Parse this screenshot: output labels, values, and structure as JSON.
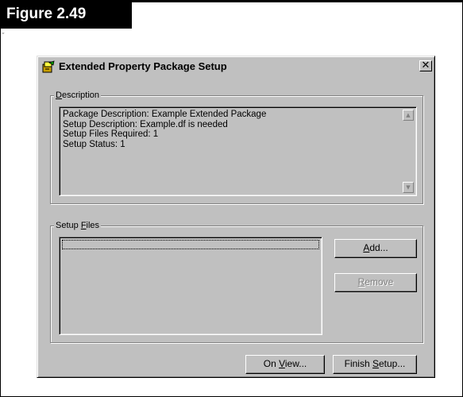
{
  "figure": {
    "title": "Figure 2.49",
    "mark": "″"
  },
  "window": {
    "title": "Extended Property Package Setup",
    "close_symbol": "✕",
    "app_icon": "package-setup-icon"
  },
  "description": {
    "label_hotkey": "D",
    "label_rest": "escription",
    "lines": [
      "Package Description: Example Extended Package",
      "Setup Description: Example.df is needed",
      "Setup Files Required: 1",
      "Setup Status: 1"
    ],
    "scroll_up": "▲",
    "scroll_down": "▼"
  },
  "setup_files": {
    "label_prefix": "Setup ",
    "label_hotkey": "F",
    "label_rest": "iles",
    "items": []
  },
  "buttons": {
    "add": {
      "hotkey": "A",
      "rest": "dd...",
      "enabled": true
    },
    "remove": {
      "hotkey": "R",
      "rest": "emove",
      "enabled": false
    },
    "on_view": {
      "prefix": "On ",
      "hotkey": "V",
      "rest": "iew..."
    },
    "finish": {
      "prefix": "Finish ",
      "hotkey": "S",
      "rest": "etup..."
    }
  },
  "colors": {
    "face": "#c0c0c0",
    "shadow": "#808080",
    "highlight": "#ffffff",
    "text": "#000000"
  }
}
